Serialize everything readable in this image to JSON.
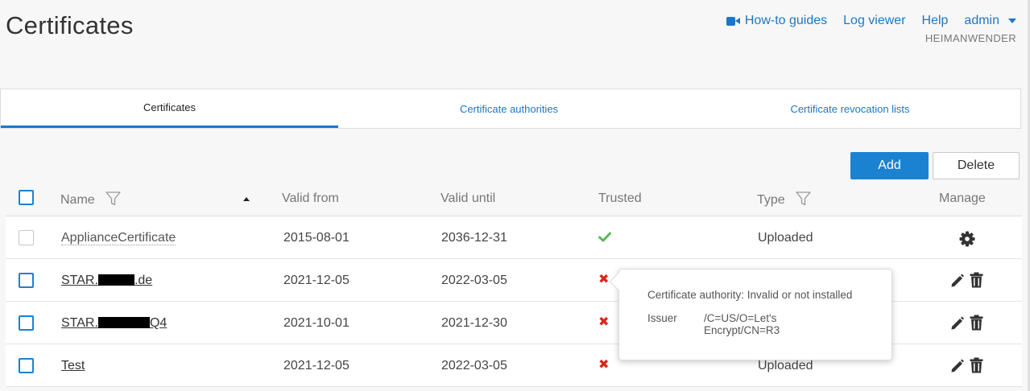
{
  "page": {
    "title": "Certificates"
  },
  "topbar": {
    "howto": "How-to guides",
    "logviewer": "Log viewer",
    "help": "Help",
    "user": "admin",
    "tenant": "HEIMANWENDER"
  },
  "tabs": [
    {
      "label": "Certificates"
    },
    {
      "label": "Certificate authorities"
    },
    {
      "label": "Certificate revocation lists"
    }
  ],
  "actions": {
    "add": "Add",
    "delete": "Delete"
  },
  "columns": {
    "name": "Name",
    "valid_from": "Valid from",
    "valid_until": "Valid until",
    "trusted": "Trusted",
    "type": "Type",
    "manage": "Manage"
  },
  "rows": [
    {
      "name_prefix": "ApplianceCertificate",
      "name_suffix": "",
      "valid_from": "2015-08-01",
      "valid_until": "2036-12-31",
      "trusted": true,
      "type": "Uploaded"
    },
    {
      "name_prefix": "STAR.",
      "name_suffix": ".de",
      "valid_from": "2021-12-05",
      "valid_until": "2022-03-05",
      "trusted": false,
      "type": "Uploaded"
    },
    {
      "name_prefix": "STAR.",
      "name_suffix": "Q4",
      "valid_from": "2021-10-01",
      "valid_until": "2021-12-30",
      "trusted": false,
      "type": "Uploaded"
    },
    {
      "name_prefix": "Test",
      "name_suffix": "",
      "valid_from": "2021-12-05",
      "valid_until": "2022-03-05",
      "trusted": false,
      "type": "Uploaded"
    }
  ],
  "tooltip": {
    "ca_text": "Certificate authority: Invalid or not installed",
    "issuer_key": "Issuer",
    "issuer_value": "/C=US/O=Let's Encrypt/CN=R3"
  },
  "colors": {
    "accent": "#1b82d1",
    "link": "#1b78c8",
    "trusted_ok": "#5cb85c",
    "untrusted": "#d9281e"
  }
}
